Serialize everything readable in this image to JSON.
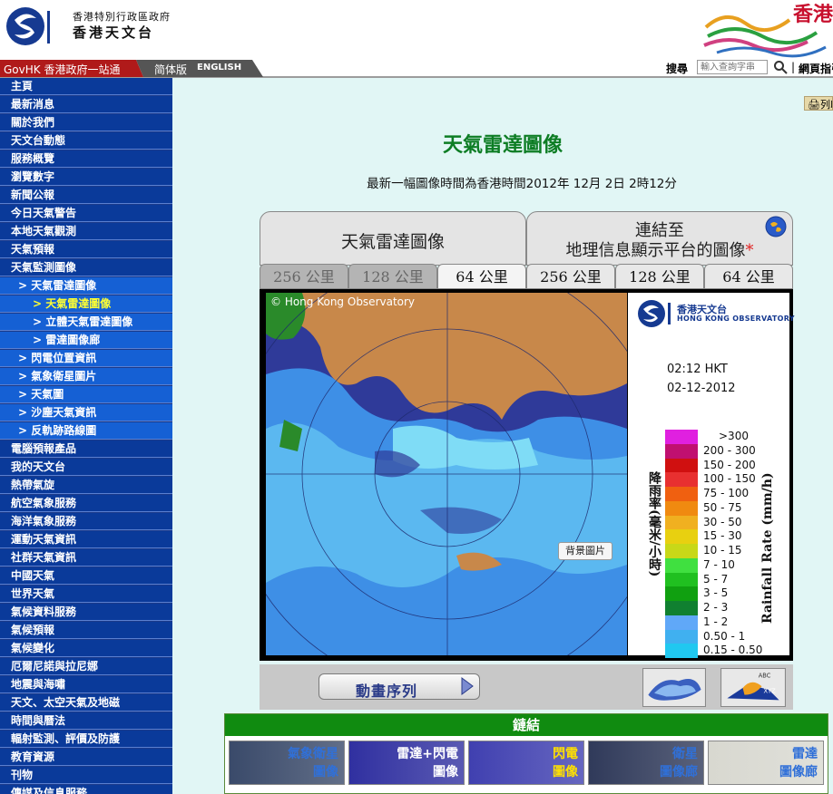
{
  "header": {
    "org_name_small": "香港特別行政區政府",
    "org_name": "香港天文台",
    "brand_text": "香港"
  },
  "topbar": {
    "govhk": "GovHK 香港政府一站通",
    "simplified": "简体版",
    "english": "ENGLISH",
    "search_label": "搜尋",
    "search_placeholder": "輸入查詢字串",
    "divider": "|",
    "sitemap": "網頁指引"
  },
  "sidebar": {
    "items": [
      {
        "label": "主頁",
        "level": 0
      },
      {
        "label": "最新消息",
        "level": 0
      },
      {
        "label": "關於我們",
        "level": 0
      },
      {
        "label": "天文台動態",
        "level": 0
      },
      {
        "label": "服務概覽",
        "level": 0
      },
      {
        "label": "瀏覽數字",
        "level": 0
      },
      {
        "label": "新聞公報",
        "level": 0
      },
      {
        "label": "今日天氣警告",
        "level": 0
      },
      {
        "label": "本地天氣觀測",
        "level": 0
      },
      {
        "label": "天氣預報",
        "level": 0
      },
      {
        "label": "天氣監測圖像",
        "level": 0
      },
      {
        "label": "> 天氣雷達圖像",
        "level": 1
      },
      {
        "label": "> 天氣雷達圖像",
        "level": 2,
        "current": true
      },
      {
        "label": "> 立體天氣雷達圖像",
        "level": 2
      },
      {
        "label": "> 雷達圖像廊",
        "level": 2
      },
      {
        "label": "> 閃電位置資訊",
        "level": 1
      },
      {
        "label": "> 氣象衛星圖片",
        "level": 1
      },
      {
        "label": "> 天氣圖",
        "level": 1
      },
      {
        "label": "> 沙塵天氣資訊",
        "level": 1
      },
      {
        "label": "> 反軌跡路線圖",
        "level": 1
      },
      {
        "label": "電腦預報產品",
        "level": 0
      },
      {
        "label": "我的天文台",
        "level": 0
      },
      {
        "label": "熱帶氣旋",
        "level": 0
      },
      {
        "label": "航空氣象服務",
        "level": 0
      },
      {
        "label": "海洋氣象服務",
        "level": 0
      },
      {
        "label": "運動天氣資訊",
        "level": 0
      },
      {
        "label": "社群天氣資訊",
        "level": 0
      },
      {
        "label": "中國天氣",
        "level": 0
      },
      {
        "label": "世界天氣",
        "level": 0
      },
      {
        "label": "氣候資料服務",
        "level": 0
      },
      {
        "label": "氣候預報",
        "level": 0
      },
      {
        "label": "氣候變化",
        "level": 0
      },
      {
        "label": "厄爾尼諾與拉尼娜",
        "level": 0
      },
      {
        "label": "地震與海嘯",
        "level": 0
      },
      {
        "label": "天文、太空天氣及地磁",
        "level": 0
      },
      {
        "label": "時間與曆法",
        "level": 0
      },
      {
        "label": "輻射監測、評價及防護",
        "level": 0
      },
      {
        "label": "教育資源",
        "level": 0
      },
      {
        "label": "刊物",
        "level": 0
      },
      {
        "label": "傳媒及信息服務",
        "level": 0
      }
    ]
  },
  "main": {
    "print_label": "列印",
    "title": "天氣雷達圖像",
    "time_line": "最新一幅圖像時間為香港時間2012年 12月 2日 2時12分",
    "tabs": {
      "radar": "天氣雷達圖像",
      "gis_line1": "連結至",
      "gis_line2": "地理信息顯示平台的圖像",
      "gis_asterisk": "*",
      "ranges_left": [
        "256  公里",
        "128  公里",
        "64  公里"
      ],
      "ranges_right": [
        "256  公里",
        "128  公里",
        "64  公里"
      ]
    },
    "map": {
      "copyright": "© Hong Kong Observatory",
      "bg_button": "背景圖片",
      "logo_zh": "香港天文台",
      "logo_en": "HONG KONG OBSERVATORY",
      "time": "02:12 HKT",
      "date": "02-12-2012",
      "axis_zh": "降雨率(毫米/小時)",
      "axis_en": "Rainfall Rate (mm/h)",
      "legend": [
        {
          "label": ">300",
          "color": "#e020e0"
        },
        {
          "label": "200 - 300",
          "color": "#c01070"
        },
        {
          "label": "150 - 200",
          "color": "#d01010"
        },
        {
          "label": "100 - 150",
          "color": "#e83030"
        },
        {
          "label": "75 - 100",
          "color": "#f06010"
        },
        {
          "label": "50 - 75",
          "color": "#f08a10"
        },
        {
          "label": "30 - 50",
          "color": "#f0b020"
        },
        {
          "label": "15 - 30",
          "color": "#e8d010"
        },
        {
          "label": "10 - 15",
          "color": "#c8d818"
        },
        {
          "label": "7 - 10",
          "color": "#40e040"
        },
        {
          "label": "5 - 7",
          "color": "#20c020"
        },
        {
          "label": "3 - 5",
          "color": "#10a010"
        },
        {
          "label": "2 - 3",
          "color": "#108030"
        },
        {
          "label": "1 - 2",
          "color": "#60a8f8"
        },
        {
          "label": "0.50 - 1",
          "color": "#40b0f0"
        },
        {
          "label": "0.15 - 0.50",
          "color": "#20c8f0"
        }
      ]
    },
    "animation_label": "動畫序列",
    "links": {
      "header": "鏈結",
      "cards": [
        {
          "line1": "氣象衛星",
          "line2": "圖像",
          "color": "#3070d8"
        },
        {
          "line1": "雷達+閃電",
          "line2": "圖像",
          "color": "#ffffff"
        },
        {
          "line1": "閃電",
          "line2": "圖像",
          "color": "#ffe000"
        },
        {
          "line1": "衛星",
          "line2": "圖像廊",
          "color": "#3070d8"
        },
        {
          "line1": "雷達",
          "line2": "圖像廊",
          "color": "#3070d8"
        }
      ]
    }
  }
}
